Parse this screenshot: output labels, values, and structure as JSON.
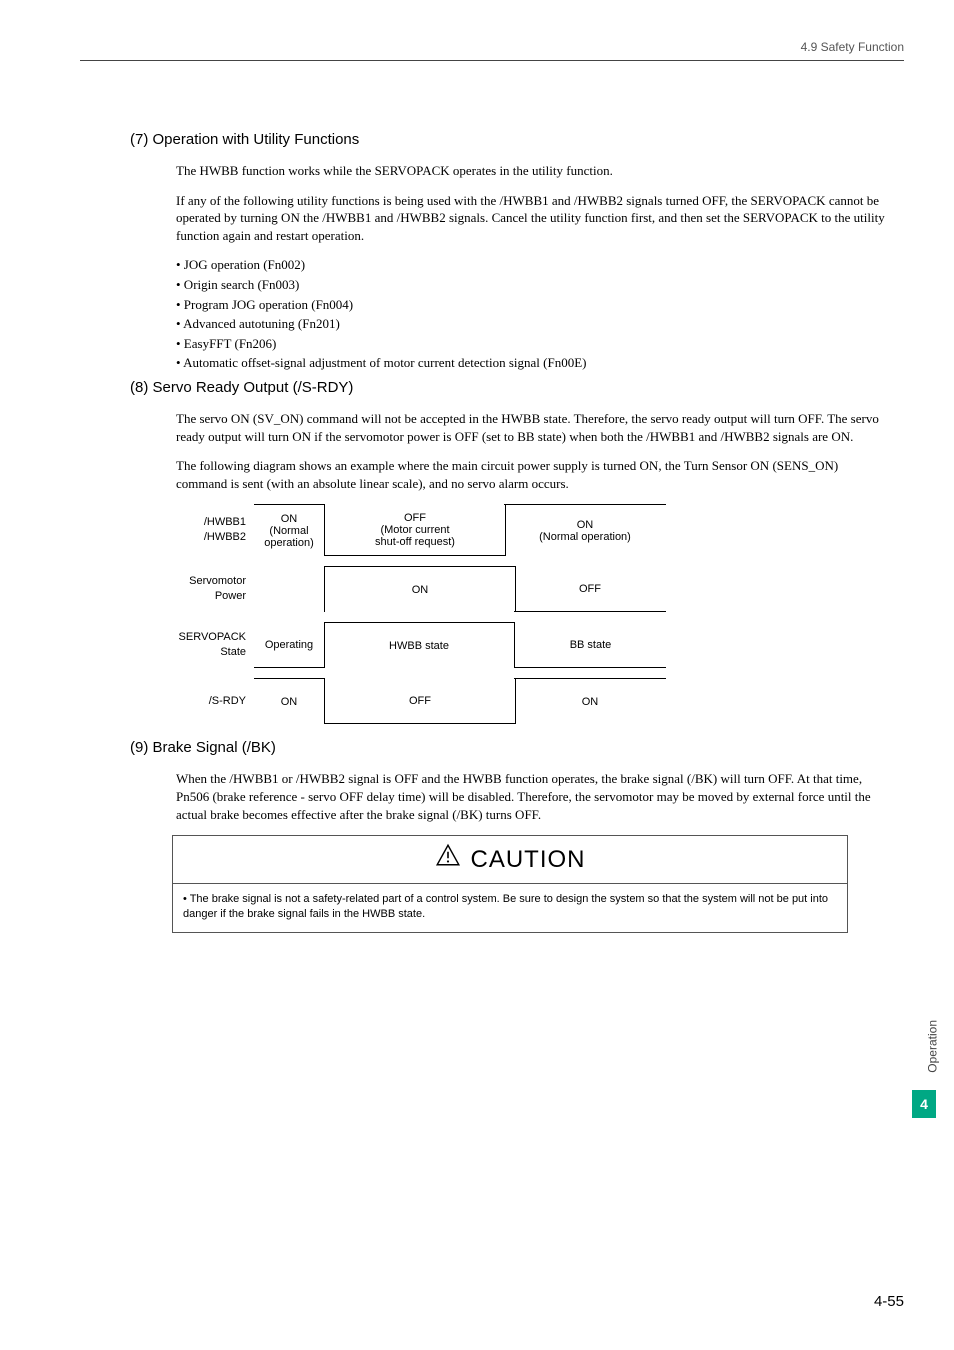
{
  "header": {
    "breadcrumb": "4.9  Safety Function"
  },
  "sec7": {
    "title": "(7)   Operation with Utility Functions",
    "p1": "The HWBB function works while the SERVOPACK operates in the utility function.",
    "p2": "If any of the following utility functions is being used with the /HWBB1 and /HWBB2 signals turned OFF, the SERVOPACK cannot be operated by turning ON the /HWBB1 and /HWBB2 signals. Cancel the utility function first, and then set the SERVOPACK to the utility function again and restart operation.",
    "items": [
      "• JOG operation (Fn002)",
      "• Origin search (Fn003)",
      "• Program JOG operation (Fn004)",
      "• Advanced autotuning (Fn201)",
      "• EasyFFT (Fn206)",
      "• Automatic offset-signal adjustment of motor current detection signal (Fn00E)"
    ]
  },
  "sec8": {
    "title": "(8)   Servo Ready Output (/S-RDY)",
    "p1": "The servo ON (SV_ON) command will not be accepted in the HWBB state. Therefore, the servo ready output will turn OFF. The servo ready output will turn ON if the servomotor power is OFF (set to BB state) when both the /HWBB1 and /HWBB2 signals are ON.",
    "p2": "The following diagram shows an example where the main circuit power supply is turned ON, the Turn Sensor ON (SENS_ON) command is sent (with an absolute linear scale), and no servo alarm occurs."
  },
  "diagram": {
    "rows": {
      "hwbb": {
        "label": "/HWBB1\n/HWBB2",
        "left": "ON\n(Normal\noperation)",
        "mid": "OFF\n(Motor current\nshut-off request)",
        "right": "ON\n(Normal operation)"
      },
      "power": {
        "label": "Servomotor\nPower",
        "left": "",
        "mid": "ON",
        "right": "OFF"
      },
      "state": {
        "label": "SERVOPACK\nState",
        "left": "Operating",
        "mid": "HWBB state",
        "right": "BB state"
      },
      "srdy": {
        "label": "/S-RDY",
        "left": "ON",
        "mid": "OFF",
        "right": "ON"
      }
    }
  },
  "sec9": {
    "title": "(9)   Brake Signal (/BK)",
    "p1": "When the /HWBB1 or /HWBB2 signal is OFF and the HWBB function operates, the brake signal (/BK) will turn OFF. At that time, Pn506 (brake reference - servo OFF delay time) will be disabled. Therefore, the servomotor may be moved by external force until the actual brake becomes effective after the brake signal (/BK) turns OFF."
  },
  "caution": {
    "heading": "CAUTION",
    "body": "•  The brake signal is not a safety-related part of a control system. Be sure to design the system so that the system will not be put into danger if the brake signal fails in the HWBB state."
  },
  "side": {
    "label": "Operation",
    "num": "4"
  },
  "page": "4-55"
}
